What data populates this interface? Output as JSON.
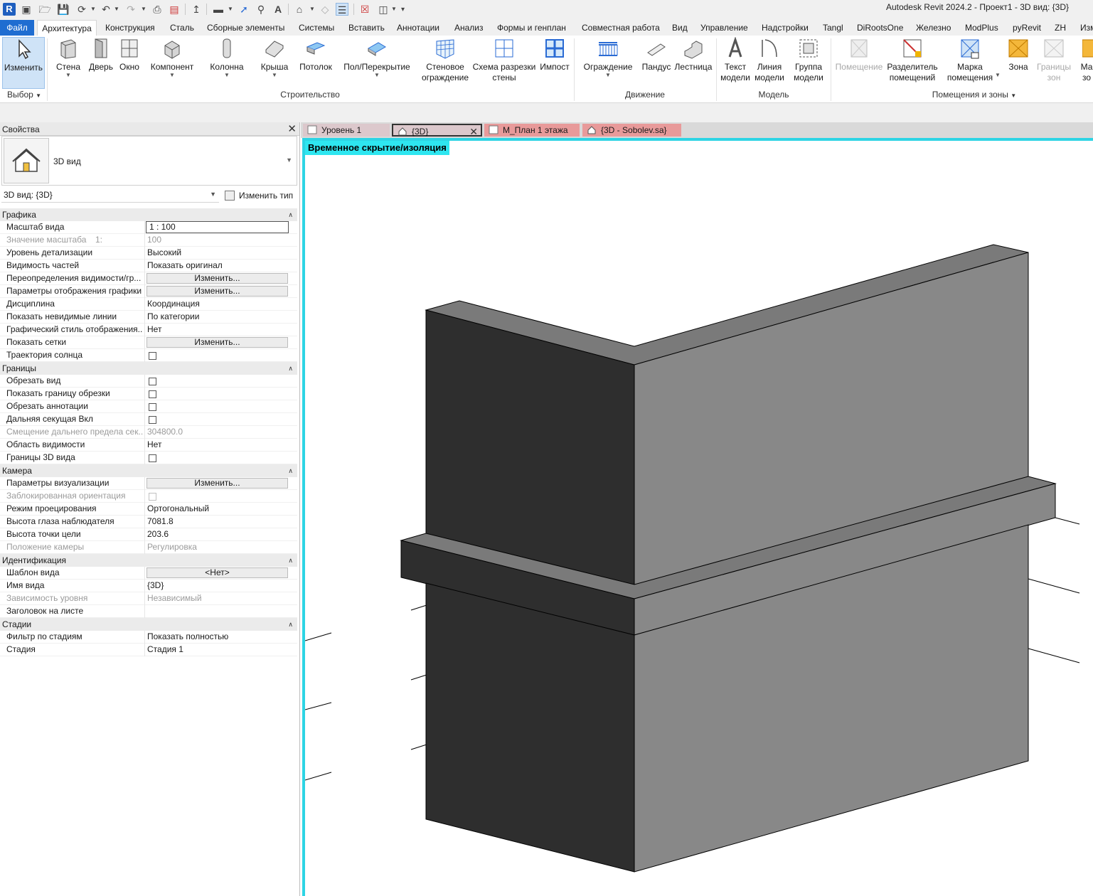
{
  "app": {
    "logo": "R",
    "title": "Autodesk Revit 2024.2 - Проект1 - 3D вид: {3D}"
  },
  "qat_icons": [
    "new-file-icon",
    "open-icon",
    "save-icon",
    "sync-icon",
    "undo-icon",
    "redo-icon",
    "print-icon",
    "sheet-icon",
    "aligned-dimension-icon",
    "measure-icon",
    "tag-icon",
    "text-icon",
    "3d-view-icon",
    "section-icon",
    "thin-lines-icon",
    "close-hidden-icon",
    "switch-windows-icon",
    "customize-icon"
  ],
  "menu": {
    "file": "Файл",
    "tabs": [
      "Архитектура",
      "Конструкция",
      "Сталь",
      "Сборные элементы",
      "Системы",
      "Вставить",
      "Аннотации",
      "Анализ",
      "Формы и генплан",
      "Совместная работа",
      "Вид",
      "Управление",
      "Надстройки",
      "Tangl",
      "DiRootsOne",
      "Железно",
      "ModPlus",
      "pyRevit",
      "ZH",
      "Изм"
    ],
    "active": "Архитектура"
  },
  "ribbon": {
    "buttons": [
      {
        "label": "Изменить",
        "icon": "cursor-icon",
        "selected": true
      },
      {
        "label": "Стена",
        "icon": "wall-icon",
        "caret": true
      },
      {
        "label": "Дверь",
        "icon": "door-icon"
      },
      {
        "label": "Окно",
        "icon": "window-icon"
      },
      {
        "label": "Компонент",
        "icon": "component-icon",
        "caret": true
      },
      {
        "label": "Колонна",
        "icon": "column-icon",
        "caret": true
      },
      {
        "label": "Крыша",
        "icon": "roof-icon",
        "caret": true
      },
      {
        "label": "Потолок",
        "icon": "ceiling-icon"
      },
      {
        "label": "Пол/Перекрытие",
        "icon": "floor-icon",
        "caret": true
      },
      {
        "label": "Стеновое ограждение",
        "icon": "curtain-system-icon"
      },
      {
        "label": "Схема разрезки стены",
        "icon": "curtain-grid-icon"
      },
      {
        "label": "Импост",
        "icon": "mullion-icon"
      },
      {
        "label": "Ограждение",
        "icon": "railing-icon",
        "caret": true
      },
      {
        "label": "Пандус",
        "icon": "ramp-icon"
      },
      {
        "label": "Лестница",
        "icon": "stair-icon"
      },
      {
        "label": "Текст модели",
        "icon": "model-text-icon"
      },
      {
        "label": "Линия модели",
        "icon": "model-line-icon"
      },
      {
        "label": "Группа модели",
        "icon": "model-group-icon",
        "caret": true
      },
      {
        "label": "Помещение",
        "icon": "room-icon",
        "disabled": true
      },
      {
        "label": "Разделитель помещений",
        "icon": "room-separator-icon"
      },
      {
        "label": "Марка помещения",
        "icon": "room-tag-icon",
        "caret": true
      },
      {
        "label": "Зона",
        "icon": "area-icon"
      },
      {
        "label": "Границы зон",
        "icon": "area-boundary-icon",
        "disabled": true
      },
      {
        "label": "Ма зо",
        "icon": "area-tag-icon"
      }
    ],
    "panels": {
      "select": "Выбор",
      "build": "Строительство",
      "circulation": "Движение",
      "model": "Модель",
      "rooms": "Помещения и зоны"
    }
  },
  "properties": {
    "title": "Свойства",
    "type_name": "3D вид",
    "view_selector": "3D вид: {3D}",
    "edit_type": "Изменить тип",
    "groups": [
      {
        "name": "Графика",
        "rows": [
          {
            "k": "Масштаб вида",
            "v": "1 : 100",
            "kind": "input"
          },
          {
            "k": "Значение масштаба",
            "extra": "1:",
            "v": "100",
            "muted": true
          },
          {
            "k": "Уровень детализации",
            "v": "Высокий"
          },
          {
            "k": "Видимость частей",
            "v": "Показать оригинал"
          },
          {
            "k": "Переопределения видимости/гр...",
            "v": "Изменить...",
            "kind": "button"
          },
          {
            "k": "Параметры отображения графики",
            "v": "Изменить...",
            "kind": "button"
          },
          {
            "k": "Дисциплина",
            "v": "Координация"
          },
          {
            "k": "Показать невидимые линии",
            "v": "По категории"
          },
          {
            "k": "Графический стиль отображения...",
            "v": "Нет"
          },
          {
            "k": "Показать сетки",
            "v": "Изменить...",
            "kind": "button"
          },
          {
            "k": "Траектория солнца",
            "kind": "checkbox"
          }
        ]
      },
      {
        "name": "Границы",
        "rows": [
          {
            "k": "Обрезать вид",
            "kind": "checkbox"
          },
          {
            "k": "Показать границу обрезки",
            "kind": "checkbox"
          },
          {
            "k": "Обрезать аннотации",
            "kind": "checkbox"
          },
          {
            "k": "Дальняя секущая Вкл",
            "kind": "checkbox"
          },
          {
            "k": "Смещение дальнего предела сек...",
            "v": "304800.0",
            "muted": true
          },
          {
            "k": "Область видимости",
            "v": "Нет"
          },
          {
            "k": "Границы 3D вида",
            "kind": "checkbox"
          }
        ]
      },
      {
        "name": "Камера",
        "rows": [
          {
            "k": "Параметры визуализации",
            "v": "Изменить...",
            "kind": "button"
          },
          {
            "k": "Заблокированная ориентация",
            "kind": "checkbox",
            "muted": true
          },
          {
            "k": "Режим проецирования",
            "v": "Ортогональный"
          },
          {
            "k": "Высота глаза наблюдателя",
            "v": "7081.8"
          },
          {
            "k": "Высота точки цели",
            "v": "203.6"
          },
          {
            "k": "Положение камеры",
            "v": "Регулировка",
            "muted": true
          }
        ]
      },
      {
        "name": "Идентификация",
        "rows": [
          {
            "k": "Шаблон вида",
            "v": "<Нет>",
            "kind": "button"
          },
          {
            "k": "Имя вида",
            "v": "{3D}"
          },
          {
            "k": "Зависимость уровня",
            "v": "Независимый",
            "muted": true
          },
          {
            "k": "Заголовок на листе",
            "v": ""
          }
        ]
      },
      {
        "name": "Стадии",
        "rows": [
          {
            "k": "Фильтр по стадиям",
            "v": "Показать полностью"
          },
          {
            "k": "Стадия",
            "v": "Стадия 1"
          }
        ]
      }
    ]
  },
  "view_tabs": [
    {
      "label": "Уровень 1",
      "color": "#dcc8cc",
      "icon": "floor-plan-icon"
    },
    {
      "label": "{3D}",
      "color": "#dcc8cc",
      "icon": "house-3d-icon",
      "active": true
    },
    {
      "label": "М_План 1 этажа",
      "color": "#e89a9a",
      "icon": "floor-plan-icon"
    },
    {
      "label": "{3D - Sobolev.sa}",
      "color": "#e89a9a",
      "icon": "house-3d-icon"
    }
  ],
  "canvas": {
    "banner": "Временное скрытие/изоляция",
    "banner_color": "#2ee6f0",
    "frame_color": "#2dd4e4"
  },
  "colors": {
    "accent": "#1f6dd1",
    "wall_front": "#2e2e2e",
    "wall_side": "#888888",
    "wall_top": "#7a7a7a"
  }
}
